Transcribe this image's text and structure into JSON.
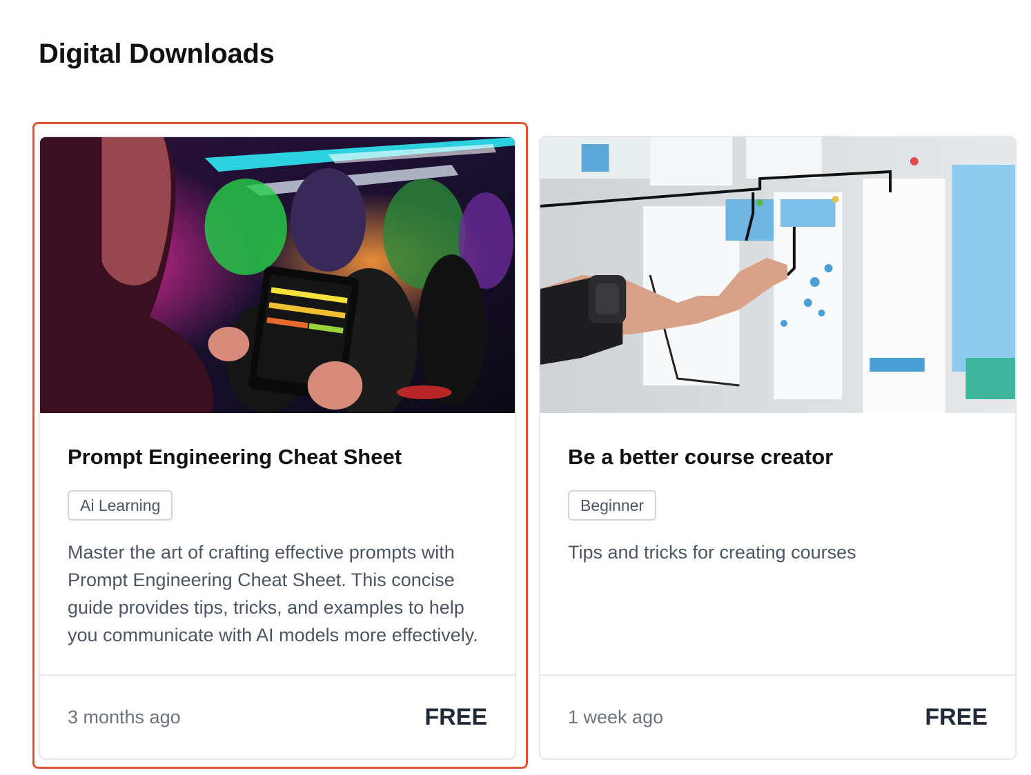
{
  "section": {
    "title": "Digital Downloads"
  },
  "cards": [
    {
      "title": "Prompt Engineering Cheat Sheet",
      "tag": "Ai Learning",
      "description": "Master the art of crafting effective prompts with Prompt Engineering Cheat Sheet. This concise guide provides tips, tricks, and examples to help you communicate with AI models more effectively.",
      "time": "3 months ago",
      "price": "FREE",
      "selected": true,
      "image": "person-with-tablet-in-neon-gym"
    },
    {
      "title": "Be a better course creator",
      "tag": "Beginner",
      "description": "Tips and tricks for creating courses",
      "time": "1 week ago",
      "price": "FREE",
      "selected": false,
      "image": "hand-pinning-wireframes-on-wall"
    }
  ],
  "colors": {
    "selection": "#e4532f",
    "border": "#e5e7eb",
    "muted": "#6b7280"
  }
}
